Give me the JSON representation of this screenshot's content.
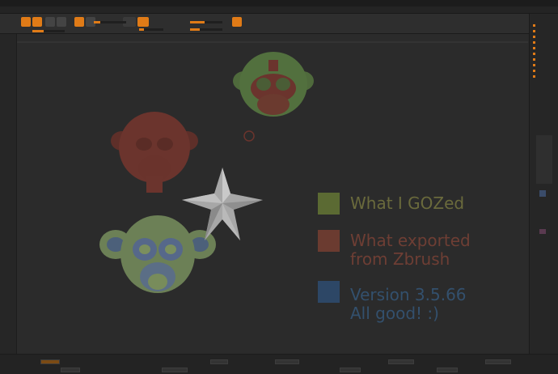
{
  "legend": [
    {
      "lines": [
        "What I GOZed"
      ],
      "color": "#5b6a33",
      "text_color": "#6a6a3c"
    },
    {
      "lines": [
        "What exported",
        "from Zbrush"
      ],
      "color": "#6b3b30",
      "text_color": "#6e3e34"
    },
    {
      "lines": [
        "Version 3.5.66",
        "All good! :)"
      ],
      "color": "#2d4766",
      "text_color": "#33506d"
    }
  ],
  "colors": {
    "accent": "#e07b17",
    "viewport": "#2b2b2b",
    "red_mesh": "#6b342d",
    "green_mesh": "#4f6a3c"
  },
  "icons": [
    "star-primitive",
    "monkey-head-red",
    "monkey-head-green-red",
    "monkey-head-green-blue",
    "brush-icon",
    "material-sphere-icon"
  ]
}
